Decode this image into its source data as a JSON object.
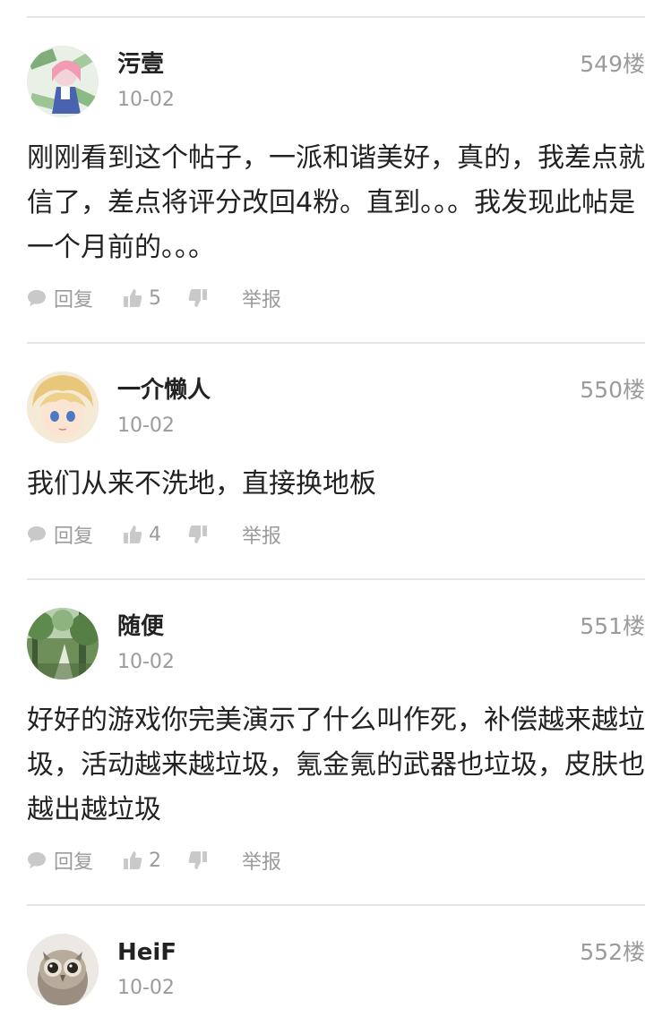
{
  "labels": {
    "reply": "回复",
    "report": "举报"
  },
  "colors": {
    "text": "#222222",
    "muted": "#9b9b9b",
    "icon": "#c9c9c9",
    "divider": "#e6e6e6"
  },
  "posts": [
    {
      "username": "污壹",
      "date": "10-02",
      "floor": "549楼",
      "content": "刚刚看到这个帖子，一派和谐美好，真的，我差点就信了，差点将评分改回4粉。直到。。。我发现此帖是一个月前的。。。",
      "likes": "5",
      "avatar": "anime-girl-money-avatar"
    },
    {
      "username": "一介懒人",
      "date": "10-02",
      "floor": "550楼",
      "content": "我们从来不洗地，直接换地板",
      "likes": "4",
      "avatar": "anime-blond-boy-avatar"
    },
    {
      "username": "随便",
      "date": "10-02",
      "floor": "551楼",
      "content": "好好的游戏你完美演示了什么叫作死，补偿越来越垃圾，活动越来越垃圾，氪金氪的武器也垃圾，皮肤也越出越垃圾",
      "likes": "2",
      "avatar": "forest-painting-avatar"
    },
    {
      "username": "HeiF",
      "date": "10-02",
      "floor": "552楼",
      "avatar": "owl-avatar"
    }
  ]
}
